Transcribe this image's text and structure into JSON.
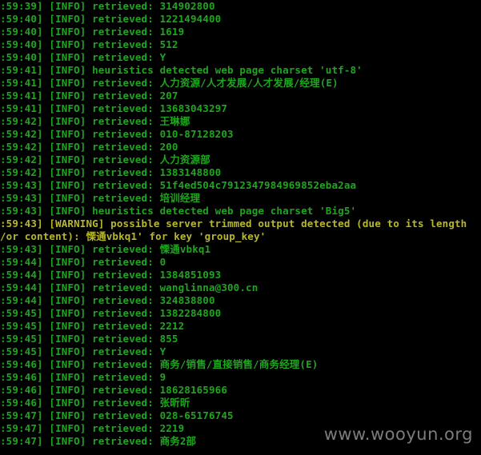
{
  "colors": {
    "background": "#000000",
    "info_text": "#1fa51f",
    "warning_text": "#b8b82a",
    "watermark": "#8a8a8a"
  },
  "console": {
    "lines": [
      {
        "text": ":59:39] [INFO] retrieved: 314902800",
        "level": "info"
      },
      {
        "text": ":59:40] [INFO] retrieved: 1221494400",
        "level": "info"
      },
      {
        "text": ":59:40] [INFO] retrieved: 1619",
        "level": "info"
      },
      {
        "text": ":59:40] [INFO] retrieved: 512",
        "level": "info"
      },
      {
        "text": ":59:40] [INFO] retrieved: Y",
        "level": "info"
      },
      {
        "text": ":59:41] [INFO] heuristics detected web page charset 'utf-8'",
        "level": "info"
      },
      {
        "text": ":59:41] [INFO] retrieved: 人力资源/人才发展/人才发展/经理(E)",
        "level": "info"
      },
      {
        "text": ":59:41] [INFO] retrieved: 207",
        "level": "info"
      },
      {
        "text": ":59:41] [INFO] retrieved: 13683043297",
        "level": "info"
      },
      {
        "text": ":59:42] [INFO] retrieved: 王琳娜",
        "level": "info"
      },
      {
        "text": ":59:42] [INFO] retrieved: 010-87128203",
        "level": "info"
      },
      {
        "text": ":59:42] [INFO] retrieved: 200",
        "level": "info"
      },
      {
        "text": ":59:42] [INFO] retrieved: 人力资源部",
        "level": "info"
      },
      {
        "text": ":59:42] [INFO] retrieved: 1383148800",
        "level": "info"
      },
      {
        "text": ":59:43] [INFO] retrieved: 51f4ed504c7912347984969852eba2aa",
        "level": "info"
      },
      {
        "text": ":59:43] [INFO] retrieved: 培训经理",
        "level": "info"
      },
      {
        "text": ":59:43] [INFO] heuristics detected web page charset 'Big5'",
        "level": "info"
      },
      {
        "text": ":59:43] [WARNING] possible server trimmed output detected (due to its length",
        "level": "warning"
      },
      {
        "text": "/or content): 慄通vbkq1' for key 'group_key'",
        "level": "warning"
      },
      {
        "text": ":59:43] [INFO] retrieved: 慄通vbkq1",
        "level": "info"
      },
      {
        "text": ":59:44] [INFO] retrieved: 0",
        "level": "info"
      },
      {
        "text": ":59:44] [INFO] retrieved: 1384851093",
        "level": "info"
      },
      {
        "text": ":59:44] [INFO] retrieved: wanglinna@300.cn",
        "level": "info"
      },
      {
        "text": ":59:44] [INFO] retrieved: 324838800",
        "level": "info"
      },
      {
        "text": ":59:45] [INFO] retrieved: 1382284800",
        "level": "info"
      },
      {
        "text": ":59:45] [INFO] retrieved: 2212",
        "level": "info"
      },
      {
        "text": ":59:45] [INFO] retrieved: 855",
        "level": "info"
      },
      {
        "text": ":59:45] [INFO] retrieved: Y",
        "level": "info"
      },
      {
        "text": ":59:46] [INFO] retrieved: 商务/销售/直接销售/商务经理(E)",
        "level": "info"
      },
      {
        "text": ":59:46] [INFO] retrieved: 9",
        "level": "info"
      },
      {
        "text": ":59:46] [INFO] retrieved: 18628165966",
        "level": "info"
      },
      {
        "text": ":59:46] [INFO] retrieved: 张昕昕",
        "level": "info"
      },
      {
        "text": ":59:47] [INFO] retrieved: 028-65176745",
        "level": "info"
      },
      {
        "text": ":59:47] [INFO] retrieved: 2219",
        "level": "info"
      },
      {
        "text": ":59:47] [INFO] retrieved: 商务2部",
        "level": "info"
      }
    ]
  },
  "watermark": {
    "text": "www.wooyun.org"
  }
}
